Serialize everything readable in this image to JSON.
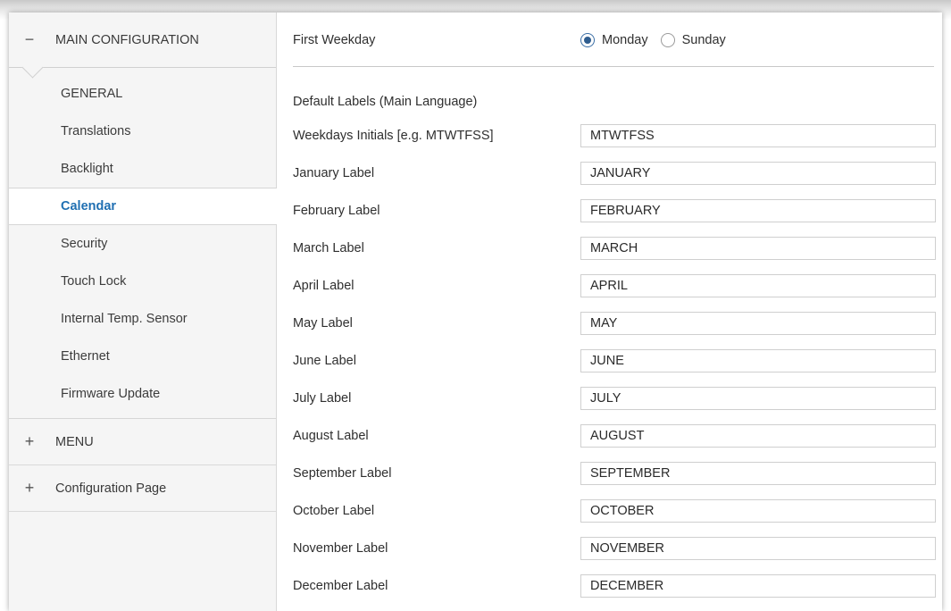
{
  "sidebar": {
    "main_group": {
      "sign": "−",
      "label": "MAIN CONFIGURATION"
    },
    "items": [
      {
        "label": "GENERAL"
      },
      {
        "label": "Translations"
      },
      {
        "label": "Backlight"
      },
      {
        "label": "Calendar"
      },
      {
        "label": "Security"
      },
      {
        "label": "Touch Lock"
      },
      {
        "label": "Internal Temp. Sensor"
      },
      {
        "label": "Ethernet"
      },
      {
        "label": "Firmware Update"
      }
    ],
    "active_item": "Calendar",
    "menu_group": {
      "sign": "+",
      "label": "MENU"
    },
    "config_group": {
      "sign": "+",
      "label": "Configuration Page"
    }
  },
  "content": {
    "first_weekday": {
      "label": "First Weekday",
      "options": [
        "Monday",
        "Sunday"
      ],
      "selected": "Monday"
    },
    "section_title": "Default Labels (Main Language)",
    "fields": [
      {
        "label": "Weekdays Initials [e.g. MTWTFSS]",
        "value": "MTWTFSS"
      },
      {
        "label": "January Label",
        "value": "JANUARY"
      },
      {
        "label": "February Label",
        "value": "FEBRUARY"
      },
      {
        "label": "March Label",
        "value": "MARCH"
      },
      {
        "label": "April Label",
        "value": "APRIL"
      },
      {
        "label": "May Label",
        "value": "MAY"
      },
      {
        "label": "June Label",
        "value": "JUNE"
      },
      {
        "label": "July Label",
        "value": "JULY"
      },
      {
        "label": "August Label",
        "value": "AUGUST"
      },
      {
        "label": "September Label",
        "value": "SEPTEMBER"
      },
      {
        "label": "October Label",
        "value": "OCTOBER"
      },
      {
        "label": "November Label",
        "value": "NOVEMBER"
      },
      {
        "label": "December Label",
        "value": "DECEMBER"
      }
    ]
  },
  "colors": {
    "active_item": "#1f6fb2",
    "sidebar_bg": "#f5f5f5"
  }
}
